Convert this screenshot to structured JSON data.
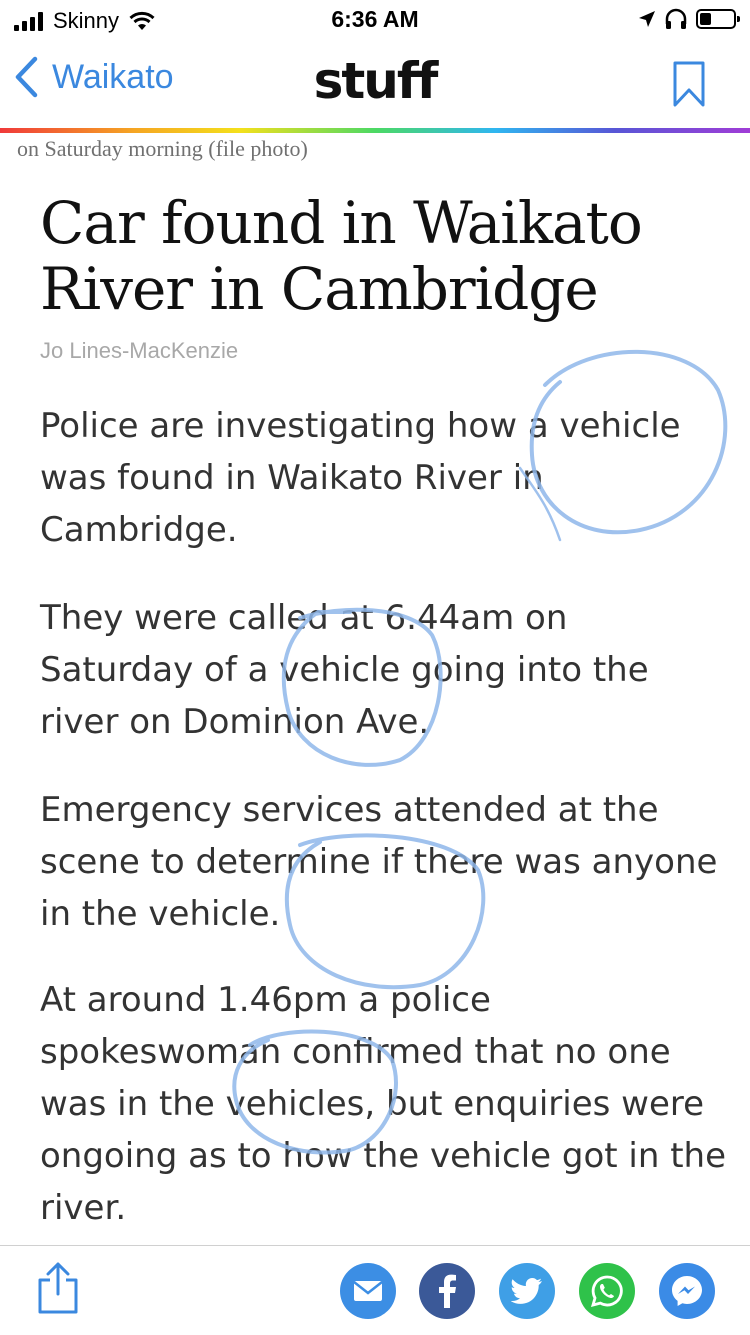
{
  "status_bar": {
    "carrier": "Skinny",
    "time": "6:36 AM",
    "battery_level": 0.35
  },
  "nav": {
    "back_label": "Waikato",
    "brand": "stuff",
    "icons": [
      "chevron-left-icon",
      "bookmark-icon"
    ]
  },
  "article": {
    "image_caption": "on Saturday morning (file photo)",
    "headline": "Car found in Waikato River in Cambridge",
    "byline": "Jo Lines-MacKenzie",
    "paragraphs": [
      "Police are investigating how a vehicle was found in Waikato River in Cambridge.",
      "They were called at 6.44am on Saturday of a vehicle going into the river on Dominion Ave.",
      "Emergency services attended at the scene to determine if there was anyone in the vehicle.",
      "At around 1.46pm a police spokeswoman confirmed that no one was in the vehicles, but enquiries were ongoing as to how the vehicle got in the river."
    ]
  },
  "share_bar": {
    "icons": [
      "share-icon",
      "email-icon",
      "facebook-icon",
      "twitter-icon",
      "whatsapp-icon",
      "messenger-icon"
    ]
  },
  "colors": {
    "accent_blue": "#3b88df",
    "annotation_blue": "#8fb7ea",
    "facebook": "#3b5998",
    "twitter": "#3f9fe6",
    "whatsapp": "#2fc24a"
  }
}
